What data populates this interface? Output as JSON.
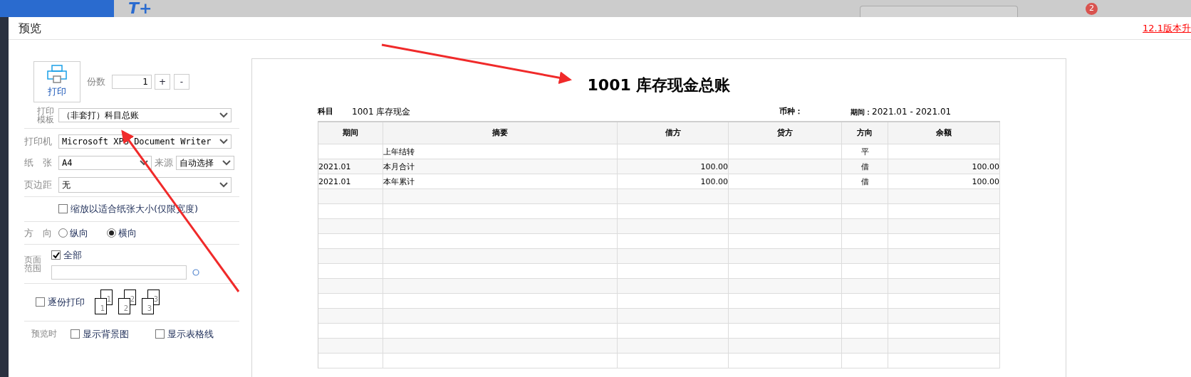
{
  "app_header": {
    "logo": "T+",
    "notification_count": "2"
  },
  "dialog": {
    "title": "预览",
    "upgrade_link": "12.1版本升"
  },
  "print_settings": {
    "print_button": "打印",
    "copies_label": "份数",
    "copies": "1",
    "increment": "+",
    "decrement": "-",
    "template_label": "打印模板",
    "template": "（非套打）科目总账",
    "printer_label": "打印机",
    "printer": "Microsoft XPS Document Writer",
    "paper_label": "纸　张",
    "paper": "A4",
    "source_label": "来源",
    "source": "自动选择",
    "margin_label": "页边距",
    "margin": "无",
    "fit_to_page": {
      "label": "缩放以适合纸张大小(仅限宽度)",
      "checked": false
    },
    "orientation_label": "方　向",
    "orientations": [
      {
        "label": "纵向",
        "selected": false
      },
      {
        "label": "横向",
        "selected": true
      }
    ],
    "range_label": "页面范围",
    "all_pages": {
      "label": "全部",
      "checked": true
    },
    "collate": {
      "label": "逐份打印",
      "checked": false
    },
    "collate_pages": [
      {
        "back": "1",
        "front": "1"
      },
      {
        "back": "2",
        "front": "2"
      },
      {
        "back": "3",
        "front": "3"
      }
    ],
    "preview_label": "预览时",
    "preview_options": [
      {
        "label": "显示背景图",
        "checked": false
      },
      {
        "label": "显示表格线",
        "checked": false
      }
    ]
  },
  "report": {
    "title": "1001 库存现金总账",
    "subject_label": "科目",
    "subject": "1001 库存现金",
    "currency_label": "币种：",
    "period_label": "期间：",
    "period": "2021.01 - 2021.01",
    "columns": [
      "期间",
      "摘要",
      "借方",
      "贷方",
      "方向",
      "余额"
    ],
    "rows": [
      [
        "",
        "上年结转",
        "",
        "",
        "平",
        ""
      ],
      [
        "2021.01",
        "本月合计",
        "100.00",
        "",
        "借",
        "100.00"
      ],
      [
        "2021.01",
        "本年累计",
        "100.00",
        "",
        "借",
        "100.00"
      ]
    ]
  }
}
